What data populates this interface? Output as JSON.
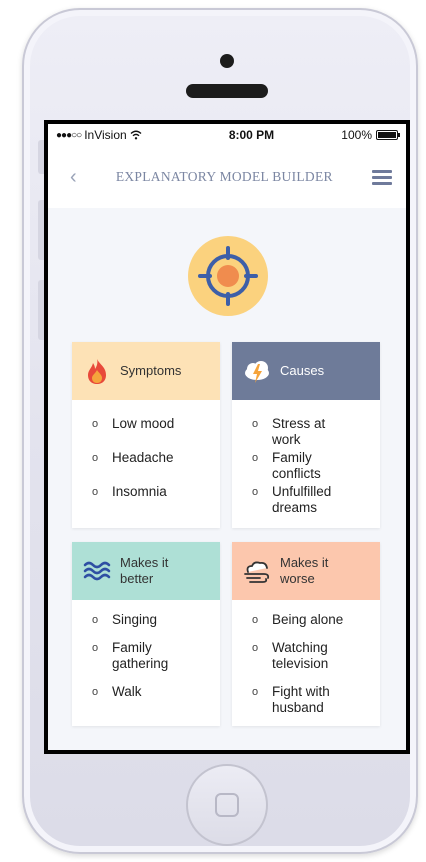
{
  "status_bar": {
    "carrier": "InVision",
    "time": "8:00 PM",
    "battery": "100%"
  },
  "nav": {
    "back_icon": "chevron-left-icon",
    "title": "EXPLANATORY MODEL BUILDER",
    "menu_icon": "hamburger-menu-icon"
  },
  "logo_icon": "target-crosshair-icon",
  "cards": {
    "symptoms": {
      "label": "Symptoms",
      "icon": "flame-icon",
      "color": "#fde2b6",
      "items": [
        "Low mood",
        "Headache",
        "Insomnia"
      ]
    },
    "causes": {
      "label": "Causes",
      "icon": "storm-cloud-icon",
      "color": "#6e7b99",
      "items": [
        "Stress at work",
        "Family conflicts",
        "Unfulfilled dreams"
      ]
    },
    "better": {
      "label": "Makes it better",
      "icon": "waves-icon",
      "color": "#aee0d6",
      "items": [
        "Singing",
        "Family gathering",
        "Walk"
      ]
    },
    "worse": {
      "label": "Makes it worse",
      "icon": "wind-cloud-icon",
      "color": "#fcc7ad",
      "items": [
        "Being alone",
        "Watching television",
        "Fight with husband"
      ]
    }
  },
  "colors": {
    "accent_orange": "#f08c4e",
    "logo_yellow": "#fbd27e",
    "title_gray": "#7b86a2"
  }
}
